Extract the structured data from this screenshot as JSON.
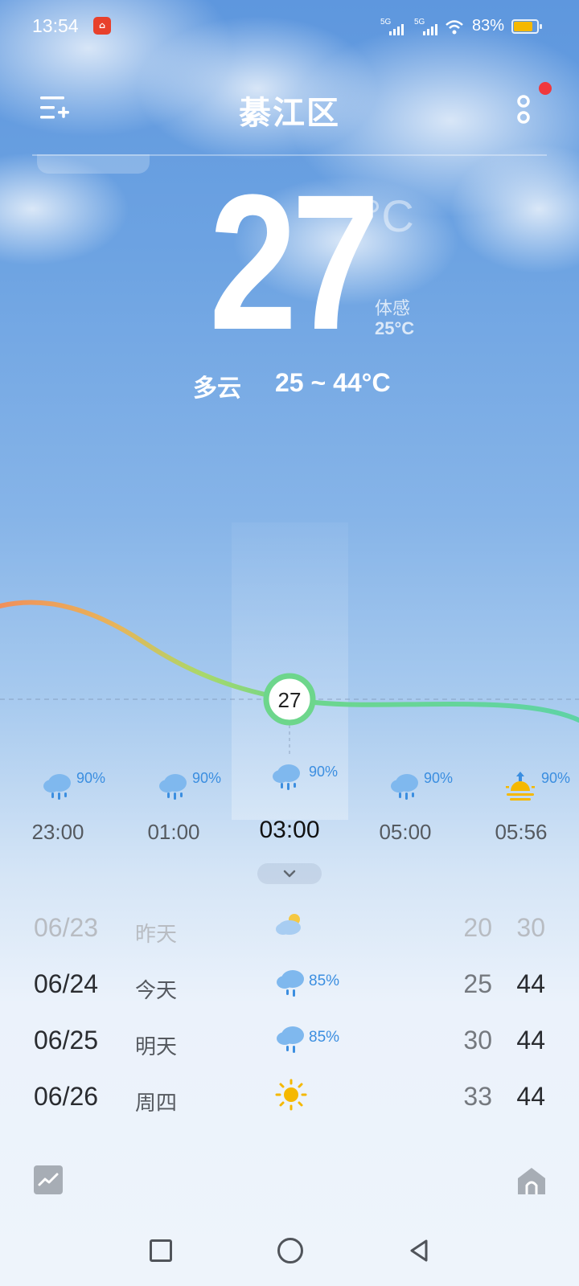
{
  "status": {
    "time": "13:54",
    "signal1": "5G",
    "signal2": "5G",
    "battery": "83%",
    "battery_level": 0.83
  },
  "header": {
    "city": "綦江区",
    "menu_icon": "list-add-icon",
    "more_icon": "more-vertical-icon"
  },
  "current": {
    "temp": "27",
    "unit": "°C",
    "feels_label": "体感",
    "feels_value": "25°C",
    "condition": "多云",
    "range": "25 ~ 44°C"
  },
  "hourly": {
    "selected": "27",
    "items": [
      {
        "time": "23:00",
        "pct": "90%",
        "icon": "rain-cloud-icon"
      },
      {
        "time": "01:00",
        "pct": "90%",
        "icon": "rain-cloud-icon"
      },
      {
        "time": "03:00",
        "pct": "90%",
        "icon": "rain-cloud-icon"
      },
      {
        "time": "05:00",
        "pct": "90%",
        "icon": "rain-cloud-icon"
      },
      {
        "time": "05:56",
        "pct": "90%",
        "icon": "sunrise-icon"
      }
    ]
  },
  "daily": [
    {
      "date": "06/23",
      "name": "昨天",
      "pct": "",
      "low": "20",
      "high": "30",
      "icon": "partly-cloudy-icon"
    },
    {
      "date": "06/24",
      "name": "今天",
      "pct": "85%",
      "low": "25",
      "high": "44",
      "icon": "rain-cloud-icon"
    },
    {
      "date": "06/25",
      "name": "明天",
      "pct": "85%",
      "low": "30",
      "high": "44",
      "icon": "rain-cloud-icon"
    },
    {
      "date": "06/26",
      "name": "周四",
      "pct": "",
      "low": "33",
      "high": "44",
      "icon": "sun-icon"
    }
  ],
  "colors": {
    "accent_green": "#5fd39a",
    "accent_orange": "#f0905a",
    "rain_blue": "#3b8ee0",
    "sun_yellow": "#f5b800"
  }
}
